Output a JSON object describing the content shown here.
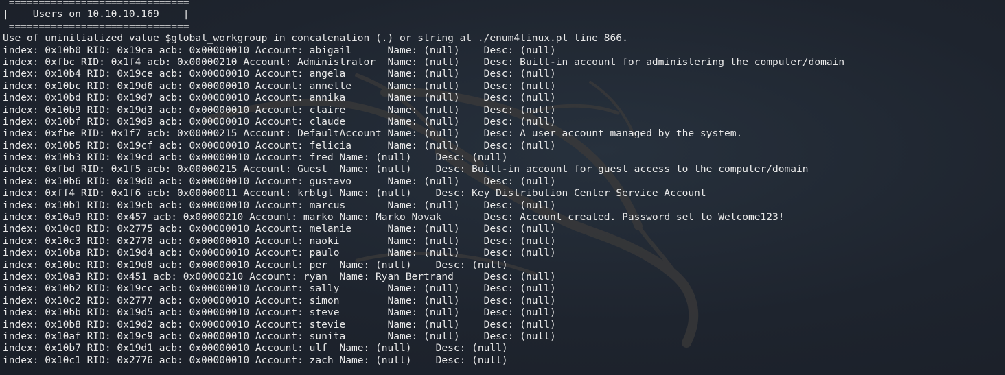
{
  "terminal": {
    "background": "#202631",
    "text_color": "#e8e8e8",
    "watermark": "kali-dragon-logo",
    "header": [
      " ==============================",
      "|    Users on 10.10.10.169    |",
      " =============================="
    ],
    "output": [
      "Use of uninitialized value $global_workgroup in concatenation (.) or string at ./enum4linux.pl line 866.",
      "index: 0x10b0 RID: 0x19ca acb: 0x00000010 Account: abigail      Name: (null)    Desc: (null)",
      "index: 0xfbc RID: 0x1f4 acb: 0x00000210 Account: Administrator  Name: (null)    Desc: Built-in account for administering the computer/domain",
      "index: 0x10b4 RID: 0x19ce acb: 0x00000010 Account: angela       Name: (null)    Desc: (null)",
      "index: 0x10bc RID: 0x19d6 acb: 0x00000010 Account: annette      Name: (null)    Desc: (null)",
      "index: 0x10bd RID: 0x19d7 acb: 0x00000010 Account: annika       Name: (null)    Desc: (null)",
      "index: 0x10b9 RID: 0x19d3 acb: 0x00000010 Account: claire       Name: (null)    Desc: (null)",
      "index: 0x10bf RID: 0x19d9 acb: 0x00000010 Account: claude       Name: (null)    Desc: (null)",
      "index: 0xfbe RID: 0x1f7 acb: 0x00000215 Account: DefaultAccount Name: (null)    Desc: A user account managed by the system.",
      "index: 0x10b5 RID: 0x19cf acb: 0x00000010 Account: felicia      Name: (null)    Desc: (null)",
      "index: 0x10b3 RID: 0x19cd acb: 0x00000010 Account: fred Name: (null)    Desc: (null)",
      "index: 0xfbd RID: 0x1f5 acb: 0x00000215 Account: Guest  Name: (null)    Desc: Built-in account for guest access to the computer/domain",
      "index: 0x10b6 RID: 0x19d0 acb: 0x00000010 Account: gustavo      Name: (null)    Desc: (null)",
      "index: 0xff4 RID: 0x1f6 acb: 0x00000011 Account: krbtgt Name: (null)    Desc: Key Distribution Center Service Account",
      "index: 0x10b1 RID: 0x19cb acb: 0x00000010 Account: marcus       Name: (null)    Desc: (null)",
      "index: 0x10a9 RID: 0x457 acb: 0x00000210 Account: marko Name: Marko Novak       Desc: Account created. Password set to Welcome123!",
      "index: 0x10c0 RID: 0x2775 acb: 0x00000010 Account: melanie      Name: (null)    Desc: (null)",
      "index: 0x10c3 RID: 0x2778 acb: 0x00000010 Account: naoki        Name: (null)    Desc: (null)",
      "index: 0x10ba RID: 0x19d4 acb: 0x00000010 Account: paulo        Name: (null)    Desc: (null)",
      "index: 0x10be RID: 0x19d8 acb: 0x00000010 Account: per  Name: (null)    Desc: (null)",
      "index: 0x10a3 RID: 0x451 acb: 0x00000210 Account: ryan  Name: Ryan Bertrand     Desc: (null)",
      "index: 0x10b2 RID: 0x19cc acb: 0x00000010 Account: sally        Name: (null)    Desc: (null)",
      "index: 0x10c2 RID: 0x2777 acb: 0x00000010 Account: simon        Name: (null)    Desc: (null)",
      "index: 0x10bb RID: 0x19d5 acb: 0x00000010 Account: steve        Name: (null)    Desc: (null)",
      "index: 0x10b8 RID: 0x19d2 acb: 0x00000010 Account: stevie       Name: (null)    Desc: (null)",
      "index: 0x10af RID: 0x19c9 acb: 0x00000010 Account: sunita       Name: (null)    Desc: (null)",
      "index: 0x10b7 RID: 0x19d1 acb: 0x00000010 Account: ulf  Name: (null)    Desc: (null)",
      "index: 0x10c1 RID: 0x2776 acb: 0x00000010 Account: zach Name: (null)    Desc: (null)"
    ]
  }
}
